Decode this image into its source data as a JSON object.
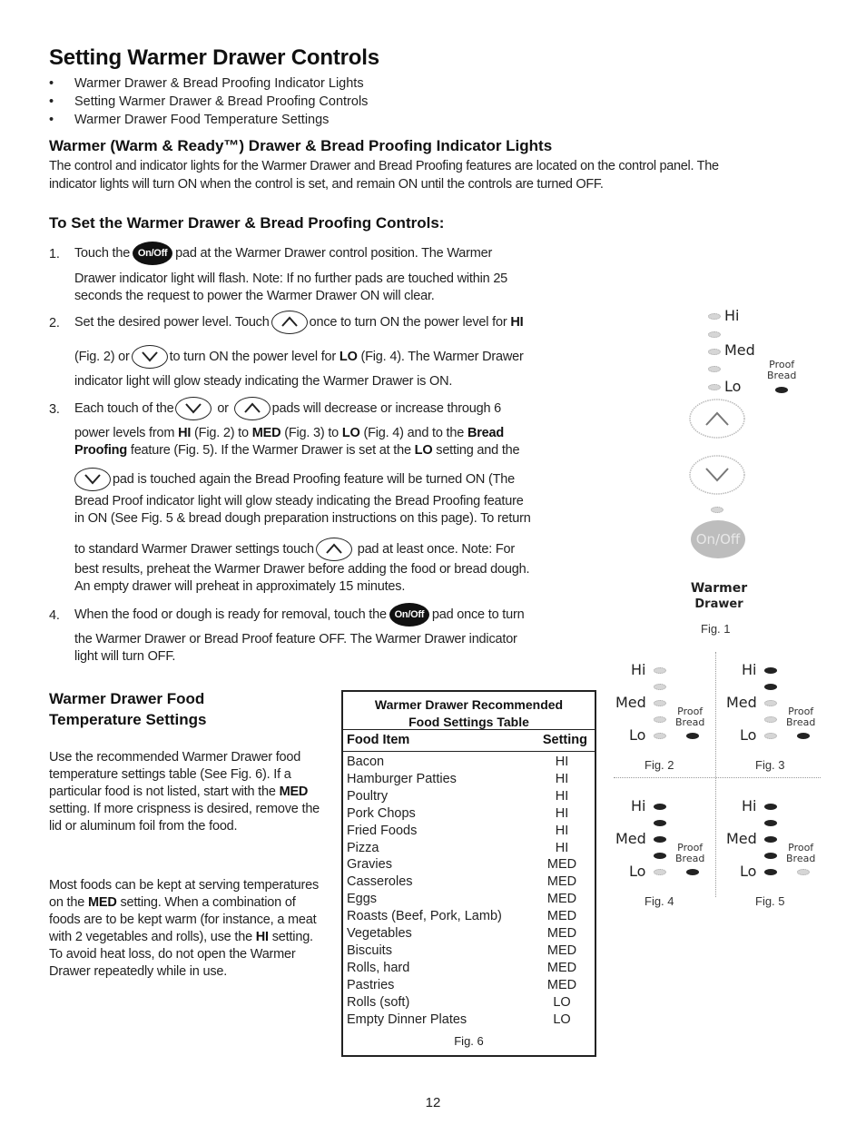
{
  "title": "Setting Warmer Drawer Controls",
  "bullets": [
    "Warmer Drawer & Bread Proofing Indicator Lights",
    "Setting Warmer Drawer & Bread Proofing Controls",
    "Warmer Drawer Food Temperature Settings"
  ],
  "indicator_section": {
    "heading": "Warmer (Warm & Ready™) Drawer & Bread Proofing Indicator Lights",
    "body_line1": "The control and indicator lights for the Warmer Drawer and Bread Proofing features are located on the control panel. The",
    "body_line2": "indicator lights will turn ON when the control is set, and remain ON until the controls are turned OFF."
  },
  "set_controls": {
    "heading": "To Set the Warmer Drawer & Bread Proofing Controls:",
    "onoff_label": "On/Off",
    "steps": {
      "s1": {
        "num": "1.",
        "l1a": "Touch the",
        "l1b": "pad at the Warmer Drawer control position. The Warmer",
        "l2": "Drawer indicator light will flash. Note: If no further pads are touched within 25",
        "l3": "seconds the request to power the Warmer Drawer ON will clear."
      },
      "s2": {
        "num": "2.",
        "l1a": "Set the desired power level. Touch",
        "l1b": "once to turn ON the power level for",
        "l1c": "HI",
        "l2a": "(Fig. 2) or",
        "l2b": "to turn ON the power level for",
        "l2c": "LO",
        "l2d": "(Fig. 4). The Warmer Drawer",
        "l3": "indicator light will glow steady indicating the Warmer Drawer is ON."
      },
      "s3": {
        "num": "3.",
        "l1a": "Each touch of the",
        "l1b": "or",
        "l1c": "pads will decrease or increase through 6",
        "l2a": "power levels from",
        "l2b": "HI",
        "l2c": "(Fig. 2) to",
        "l2d": "MED",
        "l2e": "(Fig. 3) to",
        "l2f": "LO",
        "l2g": "(Fig. 4) and to the",
        "l2h": "Bread",
        "l3a": "Proofing",
        "l3b": "feature (Fig. 5). If the Warmer Drawer is set at the",
        "l3c": "LO",
        "l3d": "setting and the",
        "l4": "pad is touched again the Bread Proofing feature will be turned ON (The",
        "l5": "Bread Proof indicator light will glow steady indicating the Bread Proofing feature",
        "l6": "in ON (See Fig. 5 & bread dough preparation instructions on this page). To return",
        "l7a": "to standard Warmer Drawer settings touch",
        "l7b": "pad at least once. Note: For",
        "l8": "best results, preheat the Warmer Drawer before adding the food or bread dough.",
        "l9": "An empty drawer will preheat in approximately 15 minutes."
      },
      "s4": {
        "num": "4.",
        "l1a": "When the food or dough is ready for removal, touch the",
        "l1b": "pad once to turn",
        "l2": "the Warmer Drawer or Bread Proof feature OFF. The Warmer Drawer indicator",
        "l3": "light will turn OFF."
      }
    }
  },
  "food_temp": {
    "heading_line1": "Warmer Drawer Food",
    "heading_line2": "Temperature Settings",
    "para1": {
      "a": "Use the recommended Warmer Drawer food temperature settings table (See Fig. 6). If a particular food is not listed, start with the",
      "b": "MED",
      "c": "setting. If more crispness is desired, remove the lid or aluminum foil from the food."
    },
    "para2": {
      "a": "Most foods can be kept at serving temperatures on the",
      "b": "MED",
      "c": "setting. When a combination of foods are to be kept warm (for instance, a meat with 2 vegetables and rolls), use the",
      "d": "HI",
      "e": "setting. To avoid heat loss, do not open the Warmer Drawer repeatedly while in use."
    }
  },
  "table": {
    "title_line1": "Warmer Drawer Recommended",
    "title_line2": "Food Settings Table",
    "col_item": "Food Item",
    "col_setting": "Setting",
    "rows": [
      {
        "item": "Bacon",
        "setting": "HI"
      },
      {
        "item": "Hamburger Patties",
        "setting": "HI"
      },
      {
        "item": "Poultry",
        "setting": "HI"
      },
      {
        "item": "Pork Chops",
        "setting": "HI"
      },
      {
        "item": "Fried Foods",
        "setting": "HI"
      },
      {
        "item": "Pizza",
        "setting": "HI"
      },
      {
        "item": "Gravies",
        "setting": "MED"
      },
      {
        "item": "Casseroles",
        "setting": "MED"
      },
      {
        "item": "Eggs",
        "setting": "MED"
      },
      {
        "item": "Roasts (Beef, Pork, Lamb)",
        "setting": "MED"
      },
      {
        "item": "Vegetables",
        "setting": "MED"
      },
      {
        "item": "Biscuits",
        "setting": "MED"
      },
      {
        "item": "Rolls, hard",
        "setting": "MED"
      },
      {
        "item": "Pastries",
        "setting": "MED"
      },
      {
        "item": "Rolls (soft)",
        "setting": "LO"
      },
      {
        "item": "Empty Dinner Plates",
        "setting": "LO"
      }
    ],
    "caption": "Fig. 6"
  },
  "fig1": {
    "labels": {
      "hi": "Hi",
      "med": "Med",
      "lo": "Lo"
    },
    "proof_line1": "Proof",
    "proof_line2": "Bread",
    "onoff_label": "On/Off",
    "panel_line1": "Warmer",
    "panel_line2": "Drawer",
    "caption": "Fig. 1",
    "lights": [
      false,
      false,
      false,
      false,
      false
    ],
    "proof_light": true
  },
  "figs": [
    {
      "caption": "Fig. 2",
      "labels": {
        "hi": "Hi",
        "med": "Med",
        "lo": "Lo"
      },
      "proof_line1": "Proof",
      "proof_line2": "Bread",
      "lights": [
        false,
        false,
        false,
        false,
        false
      ],
      "proof_light": true
    },
    {
      "caption": "Fig. 3",
      "labels": {
        "hi": "Hi",
        "med": "Med",
        "lo": "Lo"
      },
      "proof_line1": "Proof",
      "proof_line2": "Bread",
      "lights": [
        true,
        true,
        false,
        false,
        false
      ],
      "proof_light": true
    },
    {
      "caption": "Fig. 4",
      "labels": {
        "hi": "Hi",
        "med": "Med",
        "lo": "Lo"
      },
      "proof_line1": "Proof",
      "proof_line2": "Bread",
      "lights": [
        true,
        true,
        true,
        true,
        false
      ],
      "proof_light": true
    },
    {
      "caption": "Fig. 5",
      "labels": {
        "hi": "Hi",
        "med": "Med",
        "lo": "Lo"
      },
      "proof_line1": "Proof",
      "proof_line2": "Bread",
      "lights": [
        true,
        true,
        true,
        true,
        true
      ],
      "proof_light": false
    }
  ],
  "page_number": "12"
}
